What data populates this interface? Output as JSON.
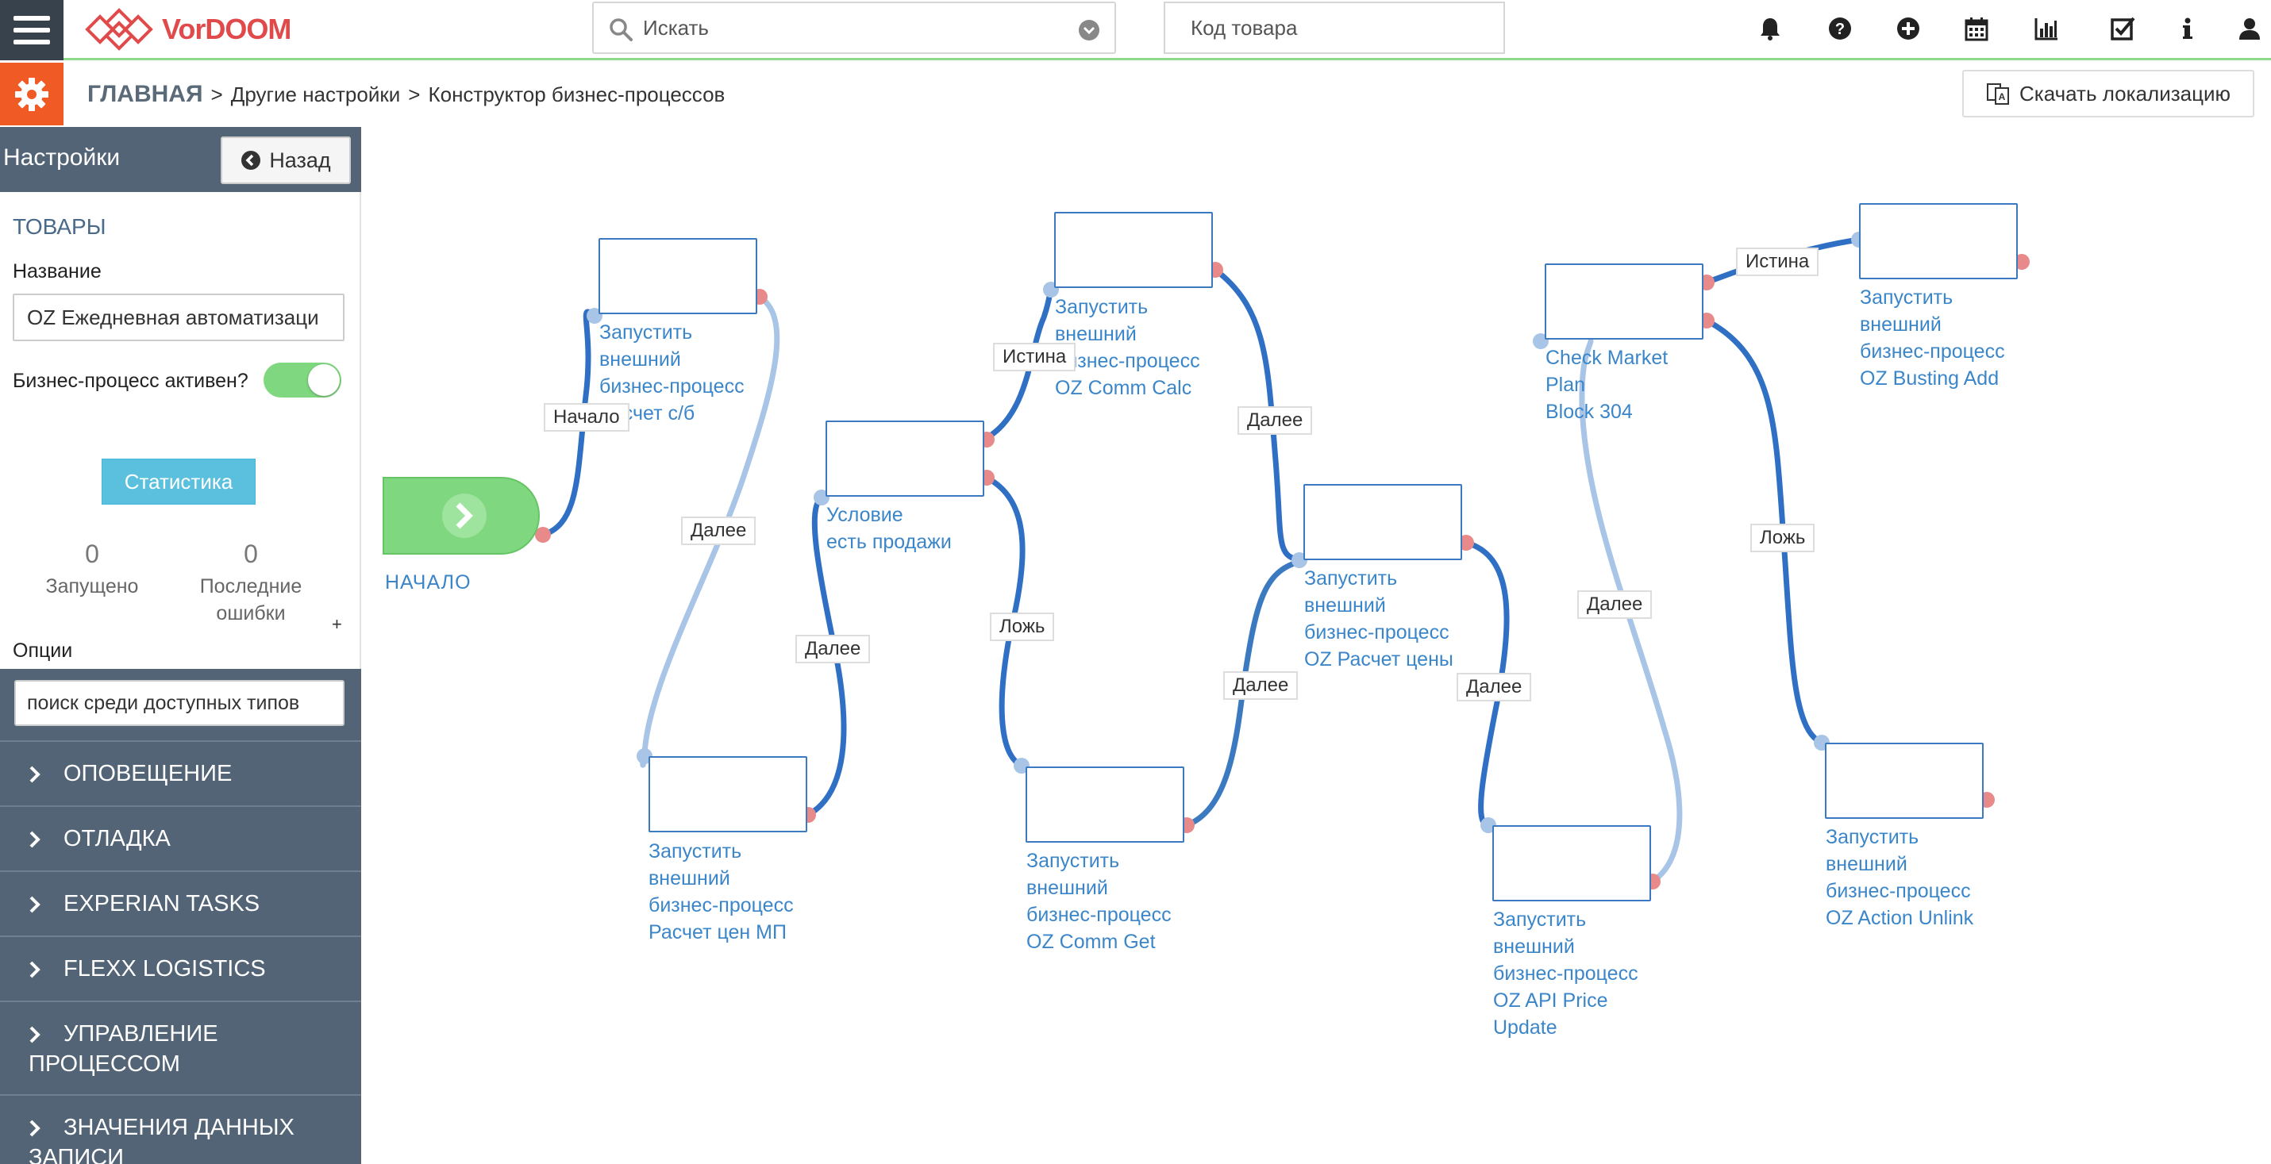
{
  "app": {
    "logo_text": "VorDOOM",
    "search_placeholder": "Искать",
    "code_placeholder": "Код товара"
  },
  "toolbar_icons": [
    "bell-icon",
    "help-icon",
    "plus-circle-icon",
    "calendar-icon",
    "bar-chart-icon",
    "checkbox-icon",
    "info-icon",
    "user-icon"
  ],
  "breadcrumb": {
    "home": "ГЛАВНАЯ",
    "item1": "Другие настройки",
    "item2": "Конструктор бизнес-процессов",
    "separator": ">"
  },
  "download_button": "Скачать локализацию",
  "sidebar": {
    "title": "Настройки",
    "back": "Назад",
    "section": "ТОВАРЫ",
    "name_label": "Название",
    "name_value": "OZ Ежедневная автоматизаци",
    "active_label": "Бизнес-процесс активен?",
    "active": true,
    "stats_button": "Статистика",
    "started_count": "0",
    "started_caption": "Запущено",
    "errors_count": "0",
    "errors_caption_1": "Последние",
    "errors_caption_2": "ошибки",
    "plus": "+",
    "options_label": "Опции",
    "types_search_placeholder": "поиск среди доступных типов",
    "categories": [
      {
        "label": "ОПОВЕЩЕНИЕ"
      },
      {
        "label": "ОТЛАДКА"
      },
      {
        "label": "EXPERIAN TASKS"
      },
      {
        "label": "FLEXX LOGISTICS"
      },
      {
        "label_1": "УПРАВЛЕНИЕ",
        "label_2": "ПРОЦЕССОМ"
      },
      {
        "label_1": "ЗНАЧЕНИЯ ДАННЫХ",
        "label_2": "ЗАПИСИ"
      }
    ]
  },
  "flow": {
    "start_label": "НАЧАЛО",
    "colors": {
      "node_border": "#3b7ac0",
      "edge_dark": "#2f6fc4",
      "edge_light": "#a8c4e6",
      "in_port": "#a8c4e6",
      "out_port": "#e88a8a",
      "start_fill": "#7fd87f"
    },
    "nodes": [
      {
        "l1": "Запустить",
        "l2": "внешний",
        "l3": "бизнес-процесс",
        "l4": "Расчет с/б"
      },
      {
        "l1": "Запустить",
        "l2": "внешний",
        "l3": "бизнес-процесс",
        "l4": "Расчет цен МП"
      },
      {
        "l1": "Условие",
        "l2": "есть продажи"
      },
      {
        "l1": "Запустить",
        "l2": "внешний",
        "l3": "бизнес-процесс",
        "l4": "OZ Comm Calc"
      },
      {
        "l1": "Запустить",
        "l2": "внешний",
        "l3": "бизнес-процесс",
        "l4": "OZ Comm Get"
      },
      {
        "l1": "Запустить",
        "l2": "внешний",
        "l3": "бизнес-процесс",
        "l4": "OZ Расчет цены"
      },
      {
        "l1": "Запустить",
        "l2": "внешний",
        "l3": "бизнес-процесс",
        "l4": "OZ API Price",
        "l5": "Update"
      },
      {
        "l1": "Check Market",
        "l2": "Plan",
        "l3": "Block 304"
      },
      {
        "l1": "Запустить",
        "l2": "внешний",
        "l3": "бизнес-процесс",
        "l4": "OZ Busting Add"
      },
      {
        "l1": "Запустить",
        "l2": "внешний",
        "l3": "бизнес-процесс",
        "l4": "OZ Action Unlink"
      }
    ],
    "edge_labels": {
      "start": "Начало",
      "next1": "Далее",
      "next2": "Далее",
      "true1": "Истина",
      "false1": "Ложь",
      "next3": "Далее",
      "next4": "Далее",
      "next5": "Далее",
      "next6": "Далее",
      "true2": "Истина",
      "false2": "Ложь"
    }
  }
}
